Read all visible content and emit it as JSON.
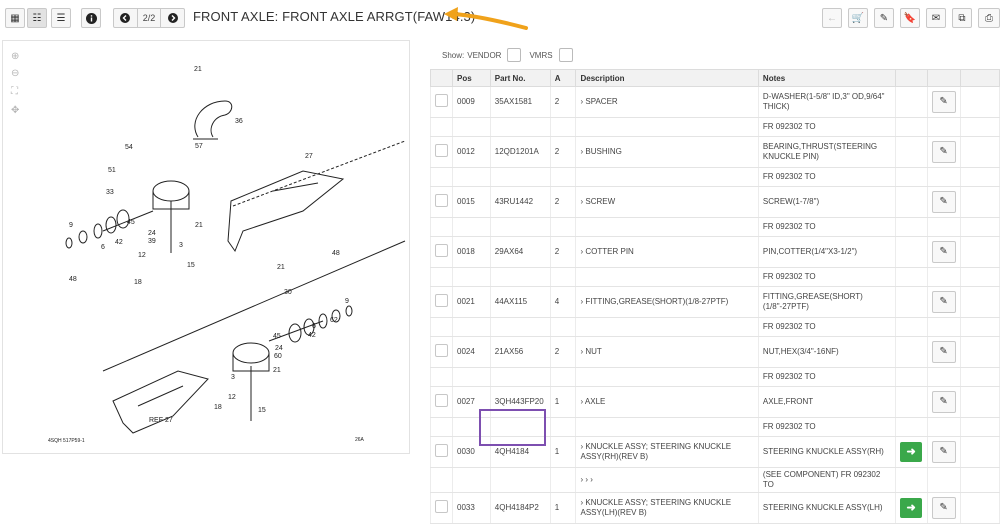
{
  "toolbar": {
    "grid_icon": "grid-icon",
    "list_icon": "list-icon",
    "menu_icon": "menu-icon",
    "info_icon": "info-icon",
    "page": "2/2",
    "title": "FRONT AXLE: FRONT AXLE ARRGT(FAW14.3)"
  },
  "right_tools": [
    "back-arrow-icon",
    "cart-icon",
    "pencil-icon",
    "bookmark-icon",
    "mail-icon",
    "copy-icon",
    "print-icon"
  ],
  "illustration": {
    "footer_left": "4SQH 517P59-1",
    "footer_right": "26A",
    "ref_label": "REF 27",
    "callouts": [
      "21",
      "36",
      "57",
      "54",
      "51",
      "33",
      "27",
      "9",
      "24",
      "39",
      "3",
      "21",
      "45",
      "42",
      "6",
      "48",
      "12",
      "15",
      "18",
      "21",
      "30",
      "48",
      "9",
      "62",
      "6",
      "42",
      "45",
      "24",
      "60",
      "21",
      "3",
      "12",
      "15",
      "18"
    ]
  },
  "filters": {
    "show_label": "Show:",
    "vendor_label": "VENDOR",
    "vmrs_label": "VMRS"
  },
  "table": {
    "headers": {
      "pos": "Pos",
      "part": "Part No.",
      "a": "A",
      "desc": "Description",
      "notes": "Notes"
    },
    "rows": [
      {
        "pos": "0009",
        "part": "35AX1581",
        "a": "2",
        "desc": "› SPACER",
        "notes": "D-WASHER(1-5/8\" ID,3\" OD,9/64\" THICK)",
        "sub": "FR 092302 TO"
      },
      {
        "pos": "0012",
        "part": "12QD1201A",
        "a": "2",
        "desc": "› BUSHING",
        "notes": "BEARING,THRUST(STEERING KNUCKLE PIN)",
        "sub": "FR 092302 TO"
      },
      {
        "pos": "0015",
        "part": "43RU1442",
        "a": "2",
        "desc": "› SCREW",
        "notes": "SCREW(1-7/8\")",
        "sub": "FR 092302 TO"
      },
      {
        "pos": "0018",
        "part": "29AX64",
        "a": "2",
        "desc": "› COTTER PIN",
        "notes": "PIN,COTTER(1/4\"X3-1/2\")",
        "sub": "FR 092302 TO"
      },
      {
        "pos": "0021",
        "part": "44AX115",
        "a": "4",
        "desc": "› FITTING,GREASE(SHORT)(1/8-27PTF)",
        "notes": "FITTING,GREASE(SHORT)(1/8\"-27PTF)",
        "sub": "FR 092302 TO"
      },
      {
        "pos": "0024",
        "part": "21AX56",
        "a": "2",
        "desc": "› NUT",
        "notes": "NUT,HEX(3/4\"-16NF)",
        "sub": "FR 092302 TO"
      },
      {
        "pos": "0027",
        "part": "3QH443FP20",
        "a": "1",
        "desc": "› AXLE",
        "notes": "AXLE,FRONT",
        "sub": "FR 092302 TO"
      },
      {
        "pos": "0030",
        "part": "4QH4184",
        "a": "1",
        "desc": "› KNUCKLE ASSY; STEERING KNUCKLE ASSY(RH)(REV B)",
        "notes": "STEERING KNUCKLE ASSY(RH)",
        "sub": "(SEE COMPONENT) FR 092302 TO",
        "sub_desc": "› › ›"
      },
      {
        "pos": "0033",
        "part": "4QH4184P2",
        "a": "1",
        "desc": "› KNUCKLE ASSY; STEERING KNUCKLE ASSY(LH)(REV B)",
        "notes": "STEERING KNUCKLE ASSY(LH)"
      }
    ]
  }
}
